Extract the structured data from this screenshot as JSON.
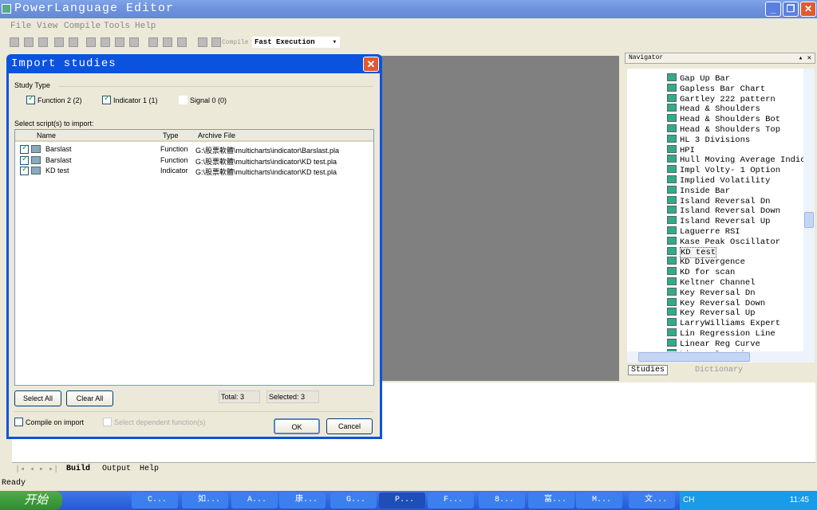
{
  "app": {
    "title": "PowerLanguage Editor",
    "menu": [
      "File",
      "View",
      "Compile",
      "Tools",
      "Help"
    ],
    "compile_label": "Compile",
    "exec_mode": "Fast Execution",
    "status": "Ready"
  },
  "navigator": {
    "title": "Navigator",
    "items": [
      "Gap Up Bar",
      "Gapless Bar Chart",
      "Gartley 222 pattern",
      "Head & Shoulders",
      "Head & Shoulders Bot",
      "Head & Shoulders Top",
      "HL 3 Divisions",
      "HPI",
      "Hull Moving Average Indicator",
      "Impl Volty- 1 Option",
      "Implied Volatility",
      "Inside Bar",
      "Island Reversal Dn",
      "Island Reversal Down",
      "Island Reversal Up",
      "Laguerre RSI",
      "Kase Peak Oscillator",
      "KD test",
      "KD Divergence",
      "KD for scan",
      "Keltner Channel",
      "Key Reversal Dn",
      "Key Reversal Down",
      "Key Reversal Up",
      "LarryWilliams Expert",
      "Lin Regression Line",
      "Linear Reg Curve",
      "Linear Reg Line"
    ],
    "selected": "KD test",
    "tabs": [
      "Studies",
      "Dictionary"
    ]
  },
  "output": {
    "tabs": [
      "Build",
      "Output",
      "Help"
    ]
  },
  "dialog": {
    "title": "Import studies",
    "study_type_label": "Study Type",
    "types": [
      {
        "label": "Function 2 (2)",
        "checked": true
      },
      {
        "label": "Indicator 1 (1)",
        "checked": true
      },
      {
        "label": "Signal 0 (0)",
        "checked": false
      }
    ],
    "select_label": "Select script(s) to import:",
    "columns": [
      "Name",
      "Type",
      "Archive File"
    ],
    "rows": [
      {
        "name": "Barslast",
        "type": "Function",
        "file": "G:\\股票軟體\\multicharts\\indicator\\Barslast.pla",
        "checked": true
      },
      {
        "name": "Barslast",
        "type": "Function",
        "file": "G:\\股票軟體\\multicharts\\indicator\\KD test.pla",
        "checked": true
      },
      {
        "name": "KD test",
        "type": "Indicator",
        "file": "G:\\股票軟體\\multicharts\\indicator\\KD test.pla",
        "checked": true
      }
    ],
    "select_all": "Select All",
    "clear_all": "Clear All",
    "total": "Total: 3",
    "selected": "Selected: 3",
    "compile_on_import": "Compile on import",
    "select_dependent": "Select dependent function(s)",
    "ok": "OK",
    "cancel": "Cancel"
  },
  "taskbar": {
    "start": "开始",
    "tasks": [
      "C...",
      "如...",
      "A...",
      "康...",
      "G...",
      "P...",
      "F...",
      "8...",
      "富...",
      "M...",
      "文..."
    ],
    "active": "P...",
    "lang": "CH",
    "clock": "11:45"
  }
}
